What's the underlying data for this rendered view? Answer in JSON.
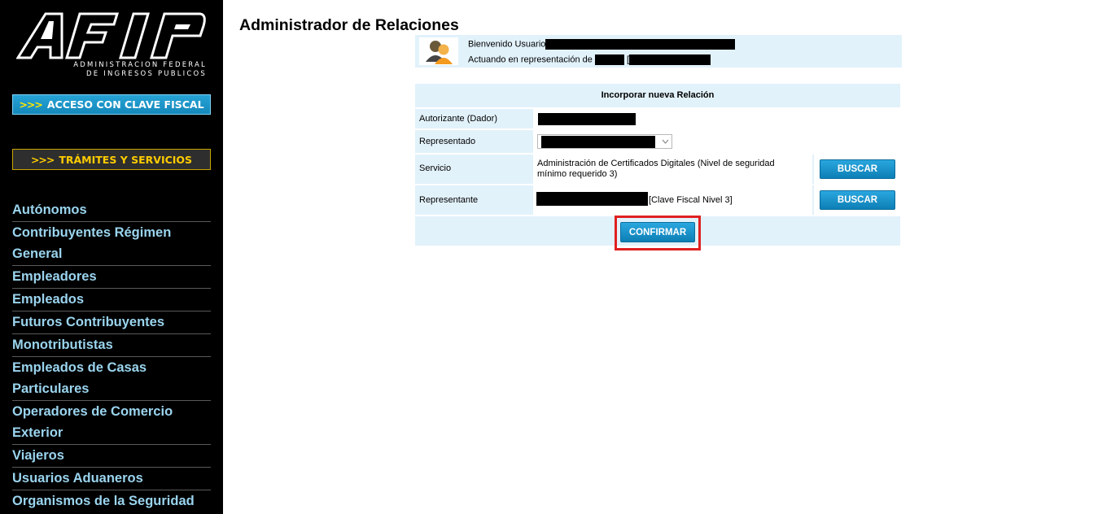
{
  "sidebar": {
    "logo_line1": "ADMINISTRACION FEDERAL",
    "logo_line2": "DE INGRESOS PUBLICOS",
    "clave_arrows": ">>>",
    "clave_label": "ACCESO CON CLAVE FISCAL",
    "tramites_arrows": ">>>",
    "tramites_label": "TRÁMITES Y SERVICIOS",
    "nav": [
      "Autónomos",
      "Contribuyentes Régimen General",
      "Empleadores",
      "Empleados",
      "Futuros Contribuyentes",
      "Monotributistas",
      "Empleados de Casas Particulares",
      "Operadores de Comercio Exterior",
      "Viajeros",
      "Usuarios Aduaneros",
      "Organismos de la Seguridad Social"
    ]
  },
  "main": {
    "title": "Administrador de Relaciones",
    "welcome": {
      "line1": "Bienvenido Usuario",
      "line2": "Actuando en representación de",
      "bracket": "["
    },
    "form": {
      "header": "Incorporar nueva Relación",
      "autorizante_label": "Autorizante (Dador)",
      "representado_label": "Representado",
      "servicio_label": "Servicio",
      "servicio_value": "Administración de Certificados Digitales (Nivel de seguridad mínimo requerido 3)",
      "representante_label": "Representante",
      "representante_suffix": "[Clave Fiscal Nivel 3]",
      "buscar_label": "BUSCAR",
      "confirm_label": "CONFIRMAR"
    }
  },
  "colors": {
    "sidebar_bg": "#000000",
    "nav_text": "#9ad4ee",
    "panel_bg": "#e2f2fb",
    "button_blue": "#1a93cc",
    "highlight_red": "#e02020"
  }
}
